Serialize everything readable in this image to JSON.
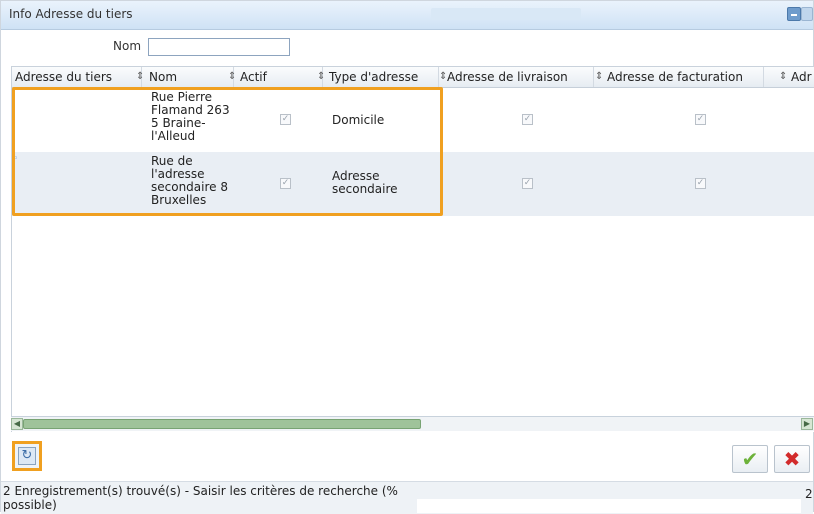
{
  "window": {
    "title": "Info Adresse du tiers"
  },
  "filter": {
    "nom_label": "Nom",
    "nom_value": ""
  },
  "grid": {
    "columns": [
      {
        "label": "Adresse du tiers"
      },
      {
        "label": "Nom"
      },
      {
        "label": "Actif"
      },
      {
        "label": "Type d'adresse"
      },
      {
        "label": "Adresse de livraison"
      },
      {
        "label": "Adresse de facturation"
      },
      {
        "label": "Adr"
      }
    ],
    "rows": [
      {
        "adresse_du_tiers": "",
        "nom": "Rue Pierre\nFlamand 263\n5 Braine-\nl'Alleud",
        "actif": true,
        "type": "Domicile",
        "livraison": true,
        "facturation": true
      },
      {
        "adresse_du_tiers": "",
        "nom": "Rue de\nl'adresse\nsecondaire 8\nBruxelles",
        "actif": true,
        "type": "Adresse\nsecondaire",
        "livraison": true,
        "facturation": true
      }
    ]
  },
  "status": {
    "message": "2 Enregistrement(s) trouvé(s) - Saisir les critères de recherche (% possible)",
    "page": "2"
  },
  "icons": {
    "sort": "sort-arrows-icon",
    "refresh": "refresh-icon",
    "ok": "checkmark-icon",
    "cancel": "cross-icon",
    "checkbox": "checkbox-checked-icon"
  },
  "colors": {
    "highlight": "#f0a020",
    "ok": "#6db23a",
    "cancel": "#d22b2b",
    "alt_row": "#e9eef4"
  }
}
